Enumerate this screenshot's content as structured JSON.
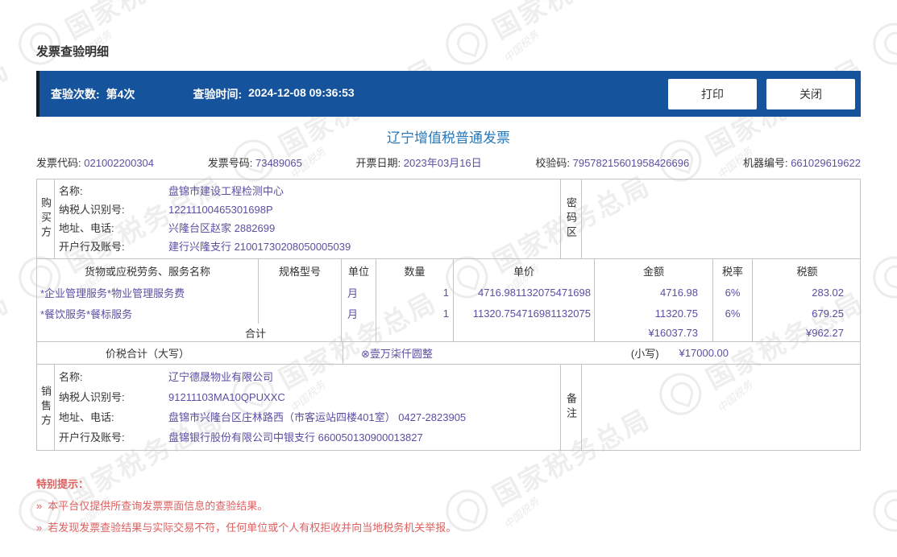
{
  "watermark": {
    "text": "国家税务总局",
    "script": "中国税务"
  },
  "page_title": "发票查验明细",
  "topbar": {
    "count_label": "查验次数:",
    "count_value": "第4次",
    "time_label": "查验时间:",
    "time_value": "2024-12-08 09:36:53",
    "print_button": "打印",
    "close_button": "关闭"
  },
  "invoice": {
    "title": "辽宁增值税普通发票",
    "meta": [
      {
        "label": "发票代码:",
        "value": "021002200304"
      },
      {
        "label": "发票号码:",
        "value": "73489065"
      },
      {
        "label": "开票日期:",
        "value": "2023年03月16日"
      },
      {
        "label": "校验码:",
        "value": "79578215601958426696"
      },
      {
        "label": "机器编号:",
        "value": "661029619622"
      }
    ],
    "buyer": {
      "side_label": "购买方",
      "fields": [
        {
          "label": "名称:",
          "value": "盘锦市建设工程检测中心"
        },
        {
          "label": "纳税人识别号:",
          "value": "12211100465301698P"
        },
        {
          "label": "地址、电话:",
          "value": "兴隆台区赵家 2882699"
        },
        {
          "label": "开户行及账号:",
          "value": "建行兴隆支行 21001730208050005039"
        }
      ],
      "password_area_label": "密码区"
    },
    "items": {
      "headers": [
        "货物或应税劳务、服务名称",
        "规格型号",
        "单位",
        "数量",
        "单价",
        "金额",
        "税率",
        "税额"
      ],
      "rows": [
        {
          "name": "*企业管理服务*物业管理服务费",
          "spec": "",
          "unit": "月",
          "qty": "1",
          "price": "4716.981132075471698",
          "amount": "4716.98",
          "tax_rate": "6%",
          "tax": "283.02"
        },
        {
          "name": "*餐饮服务*餐标服务",
          "spec": "",
          "unit": "月",
          "qty": "1",
          "price": "11320.754716981132075",
          "amount": "11320.75",
          "tax_rate": "6%",
          "tax": "679.25"
        }
      ],
      "total_label": "合计",
      "total_amount": "¥16037.73",
      "total_tax": "¥962.27"
    },
    "grand_total": {
      "label": "价税合计（大写）",
      "words": "⊗壹万柒仟圆整",
      "small_label": "(小写)",
      "figure": "¥17000.00"
    },
    "seller": {
      "side_label": "销售方",
      "fields": [
        {
          "label": "名称:",
          "value": "辽宁德晟物业有限公司"
        },
        {
          "label": "纳税人识别号:",
          "value": "91211103MA10QPUXXC"
        },
        {
          "label": "地址、电话:",
          "value": "盘锦市兴隆台区庄林路西（市客运站四楼401室） 0427-2823905"
        },
        {
          "label": "开户行及账号:",
          "value": "盘锦银行股份有限公司中银支行 660050130900013827"
        }
      ],
      "remark_label": "备注"
    }
  },
  "notice": {
    "title": "特别提示：",
    "bullet": "»",
    "items": [
      "本平台仅提供所查询发票票面信息的查验结果。",
      "若发现发票查验结果与实际交易不符，任何单位或个人有权拒收并向当地税务机关举报。"
    ]
  },
  "colors": {
    "bar_blue": "#15539c",
    "value_purple": "#5b4fa2",
    "title_blue": "#2878b8",
    "notice_red": "#dd5f5f"
  }
}
